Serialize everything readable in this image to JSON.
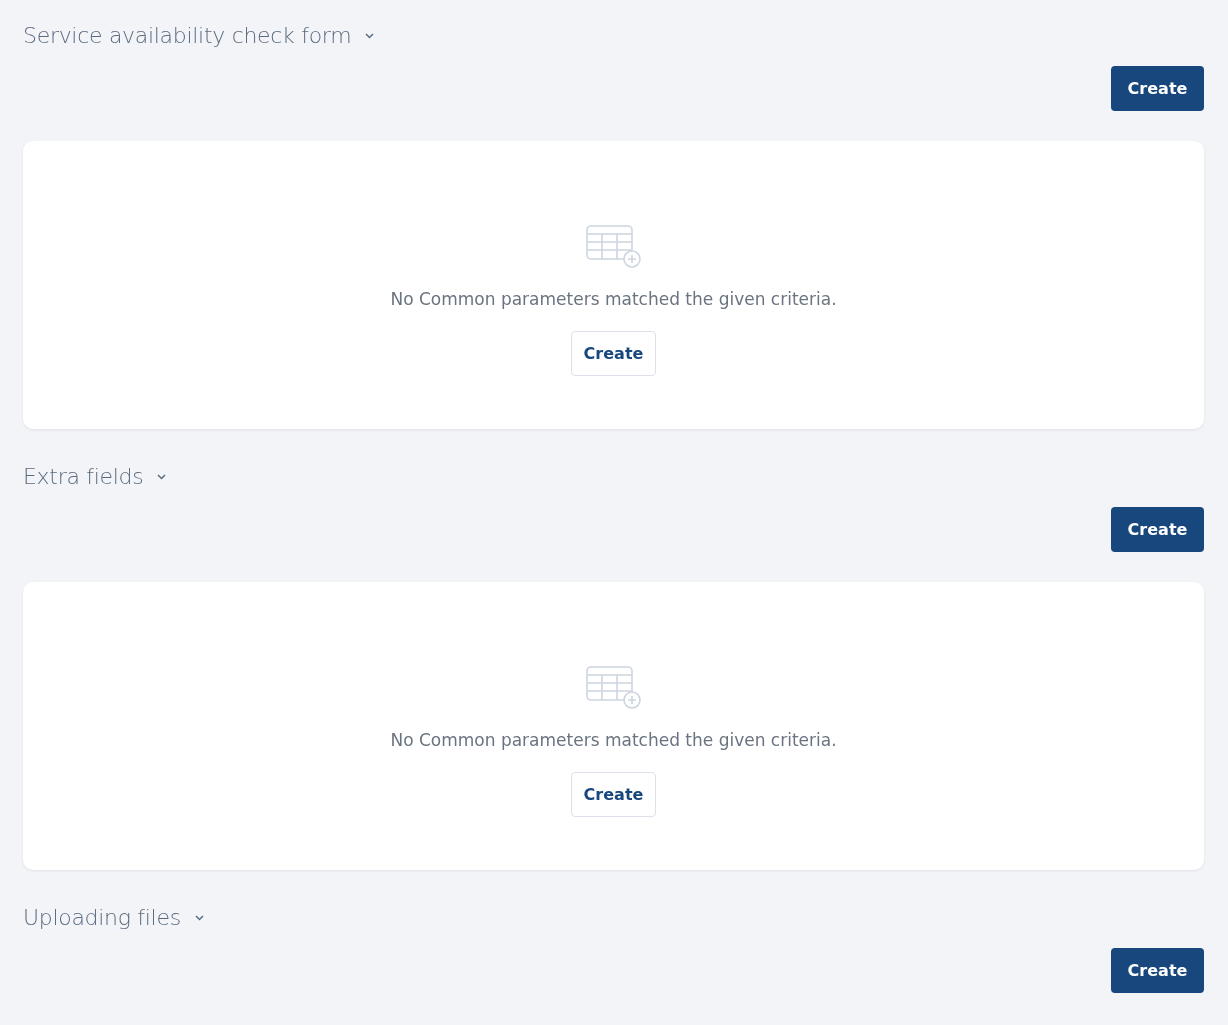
{
  "sections": [
    {
      "title": "Service availability check form",
      "create_button": "Create",
      "empty_state": {
        "message": "No Common parameters matched the given criteria.",
        "button": "Create"
      }
    },
    {
      "title": "Extra fields",
      "create_button": "Create",
      "empty_state": {
        "message": "No Common parameters matched the given criteria.",
        "button": "Create"
      }
    },
    {
      "title": "Uploading files",
      "create_button": "Create"
    }
  ]
}
